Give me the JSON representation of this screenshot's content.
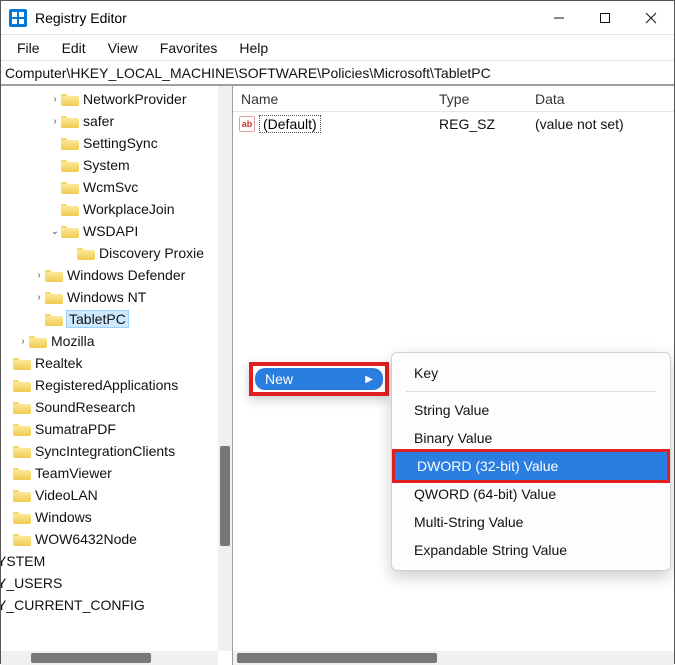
{
  "window": {
    "title": "Registry Editor"
  },
  "menu": {
    "file": "File",
    "edit": "Edit",
    "view": "View",
    "favorites": "Favorites",
    "help": "Help"
  },
  "address": "Computer\\HKEY_LOCAL_MACHINE\\SOFTWARE\\Policies\\Microsoft\\TabletPC",
  "columns": {
    "name": "Name",
    "type": "Type",
    "data": "Data"
  },
  "values": [
    {
      "name": "(Default)",
      "type": "REG_SZ",
      "data": "(value not set)"
    }
  ],
  "tree": [
    {
      "indent": 6,
      "chev": "›",
      "label": "NetworkProvider"
    },
    {
      "indent": 6,
      "chev": "›",
      "label": "safer"
    },
    {
      "indent": 6,
      "chev": "",
      "label": "SettingSync"
    },
    {
      "indent": 6,
      "chev": "",
      "label": "System"
    },
    {
      "indent": 6,
      "chev": "",
      "label": "WcmSvc"
    },
    {
      "indent": 6,
      "chev": "",
      "label": "WorkplaceJoin"
    },
    {
      "indent": 6,
      "chev": "⌄",
      "label": "WSDAPI"
    },
    {
      "indent": 7,
      "chev": "",
      "label": "Discovery Proxie"
    },
    {
      "indent": 5,
      "chev": "›",
      "label": "Windows Defender"
    },
    {
      "indent": 5,
      "chev": "›",
      "label": "Windows NT"
    },
    {
      "indent": 5,
      "chev": "",
      "label": "TabletPC",
      "selected": true
    },
    {
      "indent": 4,
      "chev": "›",
      "label": "Mozilla"
    },
    {
      "indent": 3,
      "chev": "",
      "label": "Realtek"
    },
    {
      "indent": 3,
      "chev": "",
      "label": "RegisteredApplications"
    },
    {
      "indent": 3,
      "chev": "",
      "label": "SoundResearch"
    },
    {
      "indent": 3,
      "chev": "",
      "label": "SumatraPDF"
    },
    {
      "indent": 3,
      "chev": "",
      "label": "SyncIntegrationClients"
    },
    {
      "indent": 3,
      "chev": "",
      "label": "TeamViewer"
    },
    {
      "indent": 3,
      "chev": "",
      "label": "VideoLAN"
    },
    {
      "indent": 3,
      "chev": "",
      "label": "Windows"
    },
    {
      "indent": 3,
      "chev": "",
      "label": "WOW6432Node"
    },
    {
      "indent": 2,
      "chev": "",
      "label": "'YSTEM",
      "bare": true
    },
    {
      "indent": 2,
      "chev": "",
      "label": "'Y_USERS",
      "bare": true
    },
    {
      "indent": 2,
      "chev": "",
      "label": "'Y_CURRENT_CONFIG",
      "bare": true
    }
  ],
  "context": {
    "new_label": "New",
    "sub": {
      "key": "Key",
      "string": "String Value",
      "binary": "Binary Value",
      "dword": "DWORD (32-bit) Value",
      "qword": "QWORD (64-bit) Value",
      "multi": "Multi-String Value",
      "expand": "Expandable String Value"
    }
  }
}
